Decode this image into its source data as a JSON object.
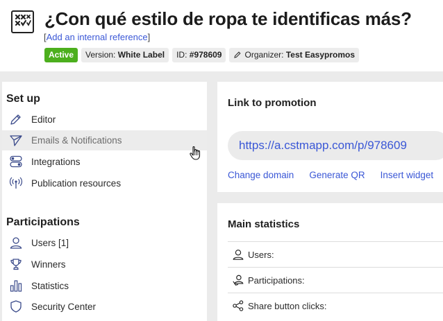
{
  "header": {
    "title": "¿Con qué estilo de ropa te identificas más?",
    "ref_open": "[",
    "ref_link": "Add an internal reference",
    "ref_close": "]",
    "badges": {
      "status": "Active",
      "version_label": "Version:",
      "version_value": "White Label",
      "id_label": "ID:",
      "id_value": "#978609",
      "organizer_label": "Organizer:",
      "organizer_value": "Test Easypromos"
    }
  },
  "sidebar": {
    "setup_title": "Set up",
    "setup_items": [
      {
        "label": "Editor",
        "icon": "pencil-icon"
      },
      {
        "label": "Emails & Notifications",
        "icon": "send-icon"
      },
      {
        "label": "Integrations",
        "icon": "toggles-icon"
      },
      {
        "label": "Publication resources",
        "icon": "broadcast-icon"
      }
    ],
    "participations_title": "Participations",
    "participation_items": [
      {
        "label": "Users [1]",
        "icon": "user-icon"
      },
      {
        "label": "Winners",
        "icon": "trophy-icon"
      },
      {
        "label": "Statistics",
        "icon": "bar-chart-icon"
      },
      {
        "label": "Security Center",
        "icon": "shield-icon"
      }
    ]
  },
  "link_panel": {
    "title": "Link to promotion",
    "url": "https://a.cstmapp.com/p/978609",
    "actions": {
      "change_domain": "Change domain",
      "generate_qr": "Generate QR",
      "insert_widget": "Insert widget"
    }
  },
  "stats_panel": {
    "title": "Main statistics",
    "rows": [
      {
        "label": "Users:",
        "icon": "user-icon"
      },
      {
        "label": "Participations:",
        "icon": "participations-icon"
      },
      {
        "label": "Share button clicks:",
        "icon": "share-icon"
      }
    ]
  },
  "colors": {
    "accent_link": "#3a57d6",
    "active_badge": "#4caf1d",
    "page_background": "#ebebeb"
  }
}
